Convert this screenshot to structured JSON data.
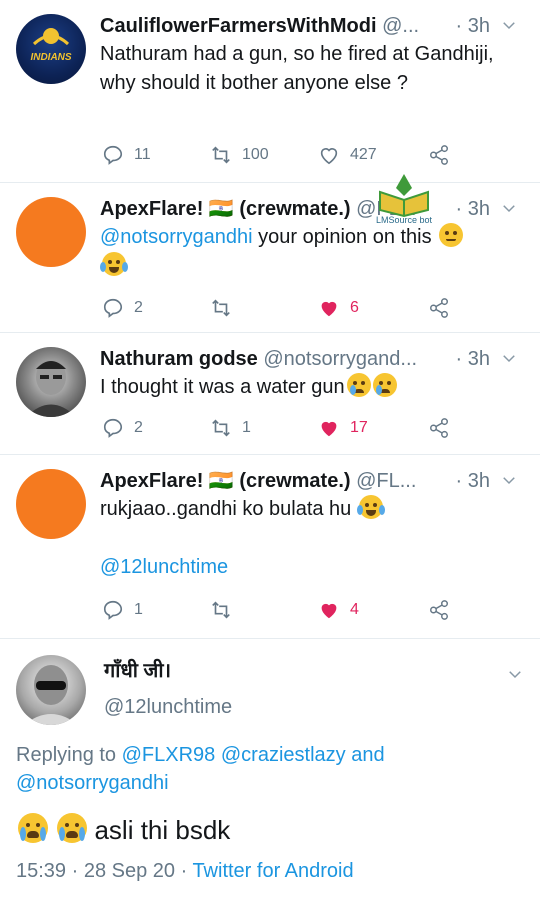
{
  "tweets": [
    {
      "name": "CauliflowerFarmersWithModi",
      "handle": "@...",
      "time": "· 3h",
      "text": "Nathuram had a gun, so he fired at Gandhiji, why should it bother anyone else ?",
      "replies": "11",
      "retweets": "100",
      "likes": "427",
      "avatar_text": "INDIANS"
    },
    {
      "name": "ApexFlare! 🇮🇳 (crewmate.)",
      "handle": "@FL...",
      "time": "· 3h",
      "mention": "@notsorrygandhi",
      "text": "your opinion on this",
      "replies": "2",
      "retweets": "",
      "likes": "6"
    },
    {
      "name": "Nathuram godse",
      "handle": "@notsorrygand...",
      "time": "· 3h",
      "text": "I thought it was a water gun",
      "replies": "2",
      "retweets": "1",
      "likes": "17"
    },
    {
      "name": "ApexFlare! 🇮🇳 (crewmate.)",
      "handle": "@FL...",
      "time": "· 3h",
      "text": "rukjaao..gandhi ko bulata hu",
      "mention": "@12lunchtime",
      "replies": "1",
      "retweets": "",
      "likes": "4"
    }
  ],
  "main": {
    "name": "गाँधी जी।",
    "handle": "@12lunchtime",
    "replying_to_label": "Replying to",
    "reply_mentions": [
      "@FLXR98",
      "@craziestlazy",
      "and",
      "@notsorrygandhi"
    ],
    "text": "asli thi bsdk",
    "timestamp": "15:39 · 28 Sep 20 ·",
    "source": "Twitter for Android"
  },
  "watermark": "LMSource bot",
  "colors": {
    "link": "#1b95e0",
    "like": "#e0245e",
    "muted": "#657786",
    "orange_avatar": "#f57a1f"
  }
}
